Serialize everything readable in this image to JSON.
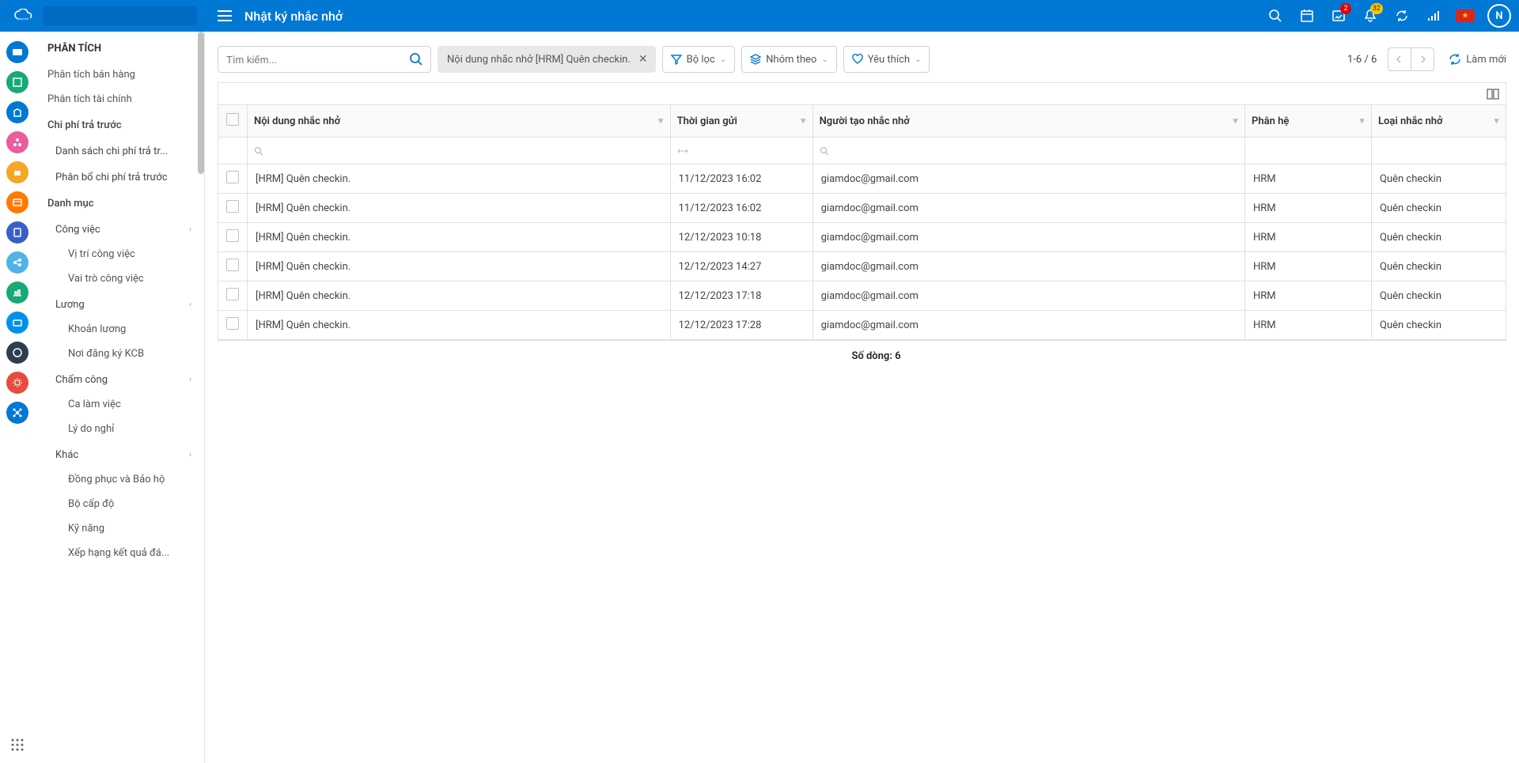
{
  "header": {
    "title": "Nhật ký nhắc nhở",
    "badges": {
      "inbox": "2",
      "bell": "32"
    },
    "avatar_letter": "N"
  },
  "sidebar": {
    "heading": "PHÂN TÍCH",
    "items": [
      {
        "label": "Phân tích bán hàng",
        "type": "item"
      },
      {
        "label": "Phân tích tài chính",
        "type": "item"
      },
      {
        "label": "Chi phí trả trước",
        "type": "group"
      },
      {
        "label": "Danh sách chi phí trả tr...",
        "type": "sub"
      },
      {
        "label": "Phân bổ chi phí trả trước",
        "type": "sub"
      },
      {
        "label": "Danh mục",
        "type": "group"
      },
      {
        "label": "Công việc",
        "type": "sub",
        "collapsible": true
      },
      {
        "label": "Vị trí công việc",
        "type": "sub2"
      },
      {
        "label": "Vai trò công việc",
        "type": "sub2"
      },
      {
        "label": "Lương",
        "type": "sub",
        "collapsible": true
      },
      {
        "label": "Khoản lương",
        "type": "sub2"
      },
      {
        "label": "Nơi đăng ký KCB",
        "type": "sub2"
      },
      {
        "label": "Chấm công",
        "type": "sub",
        "collapsible": true
      },
      {
        "label": "Ca làm việc",
        "type": "sub2"
      },
      {
        "label": "Lý do nghỉ",
        "type": "sub2"
      },
      {
        "label": "Khác",
        "type": "sub",
        "collapsible": true
      },
      {
        "label": "Đồng phục và Bảo hộ",
        "type": "sub2"
      },
      {
        "label": "Bộ cấp độ",
        "type": "sub2"
      },
      {
        "label": "Kỹ năng",
        "type": "sub2"
      },
      {
        "label": "Xếp hạng kết quả đá...",
        "type": "sub2"
      }
    ]
  },
  "toolbar": {
    "search_placeholder": "Tìm kiếm...",
    "active_filter": "Nội dung nhắc nhở [HRM] Quên checkin.",
    "filter_label": "Bộ lọc",
    "group_label": "Nhóm theo",
    "favorite_label": "Yêu thích",
    "pager": "1-6 / 6",
    "refresh_label": "Làm mới"
  },
  "table": {
    "columns": [
      "Nội dung nhắc nhở",
      "Thời gian gửi",
      "Người tạo nhắc nhở",
      "Phân hệ",
      "Loại nhắc nhở"
    ],
    "rows": [
      {
        "content": "[HRM] Quên checkin.",
        "time": "11/12/2023 16:02",
        "creator": "giamdoc@gmail.com",
        "module": "HRM",
        "type": "Quên checkin"
      },
      {
        "content": "[HRM] Quên checkin.",
        "time": "11/12/2023 16:02",
        "creator": "giamdoc@gmail.com",
        "module": "HRM",
        "type": "Quên checkin"
      },
      {
        "content": "[HRM] Quên checkin.",
        "time": "12/12/2023 10:18",
        "creator": "giamdoc@gmail.com",
        "module": "HRM",
        "type": "Quên checkin"
      },
      {
        "content": "[HRM] Quên checkin.",
        "time": "12/12/2023 14:27",
        "creator": "giamdoc@gmail.com",
        "module": "HRM",
        "type": "Quên checkin"
      },
      {
        "content": "[HRM] Quên checkin.",
        "time": "12/12/2023 17:18",
        "creator": "giamdoc@gmail.com",
        "module": "HRM",
        "type": "Quên checkin"
      },
      {
        "content": "[HRM] Quên checkin.",
        "time": "12/12/2023 17:28",
        "creator": "giamdoc@gmail.com",
        "module": "HRM",
        "type": "Quên checkin"
      }
    ],
    "footer": "Số dòng: 6"
  },
  "rail_colors": [
    "#0078d4",
    "#19a974",
    "#0078d4",
    "#e85d9e",
    "#f5a623",
    "#ff7a00",
    "#3a5fc8",
    "#4fb3e8",
    "#19a974",
    "#0091ea",
    "#2c3e50",
    "#e74c3c",
    "#0078d4"
  ]
}
